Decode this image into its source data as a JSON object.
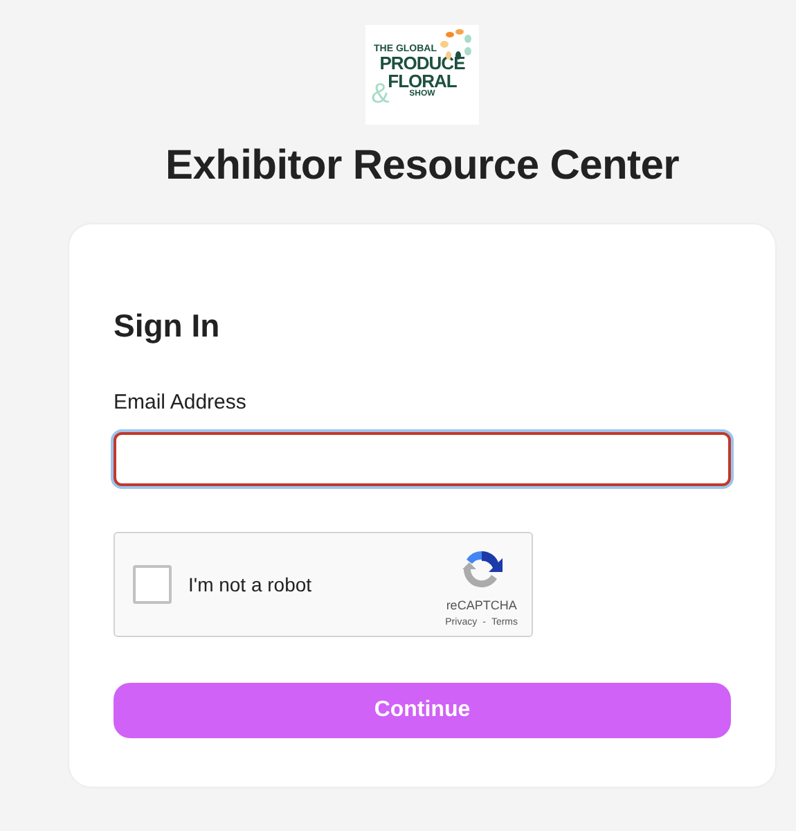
{
  "logo": {
    "lines": [
      "THE GLOBAL",
      "PRODUCE",
      "&",
      "FLORAL",
      "SHOW"
    ]
  },
  "page_title": "Exhibitor Resource Center",
  "form": {
    "title": "Sign In",
    "email": {
      "label": "Email Address",
      "invalid": true,
      "focused": true
    },
    "captcha": {
      "label": "I'm not a robot",
      "checked": false,
      "brand": "reCAPTCHA",
      "links": [
        "Privacy",
        "Terms"
      ],
      "separator": "-"
    },
    "submit": "Continue"
  }
}
